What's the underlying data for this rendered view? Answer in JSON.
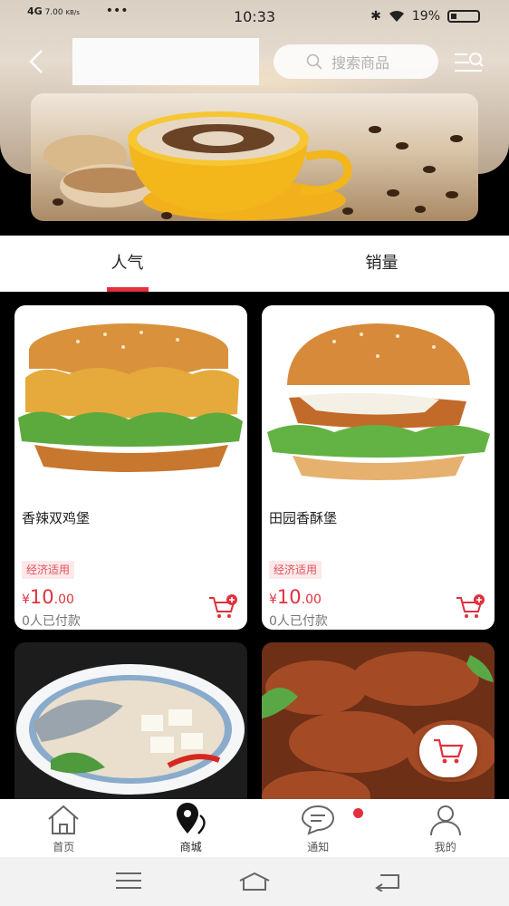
{
  "status_bar": {
    "network": "4G",
    "speed_value": "7.00",
    "speed_unit": "KB/s",
    "dots": "•••",
    "time": "10:33",
    "battery": "19%"
  },
  "header": {
    "search_placeholder": "搜索商品"
  },
  "tabs": [
    {
      "label": "人气",
      "active": true
    },
    {
      "label": "销量",
      "active": false
    }
  ],
  "products": [
    {
      "name": "香辣双鸡堡",
      "tag": "经济适用",
      "currency": "¥",
      "price_int": "10",
      "price_dec": ".00",
      "paid": "0人已付款"
    },
    {
      "name": "田园香酥堡",
      "tag": "经济适用",
      "currency": "¥",
      "price_int": "10",
      "price_dec": ".00",
      "paid": "0人已付款"
    }
  ],
  "bottom_nav": [
    {
      "label": "首页",
      "icon": "home-icon"
    },
    {
      "label": "商城",
      "icon": "location-pin-icon",
      "active": true
    },
    {
      "label": "通知",
      "icon": "chat-bubble-icon",
      "badge": true
    },
    {
      "label": "我的",
      "icon": "user-icon"
    }
  ],
  "colors": {
    "accent": "#e0313d",
    "tag_bg": "#fde9ea",
    "background": "#000000"
  }
}
